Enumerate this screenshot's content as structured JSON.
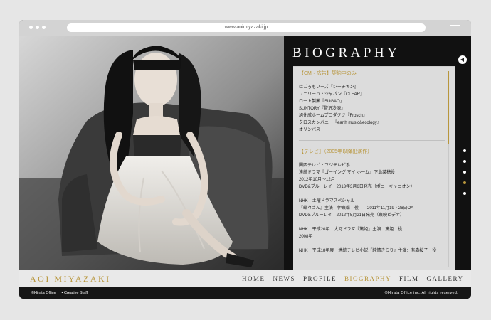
{
  "browser": {
    "url": "www.aoimiyazaki.jp"
  },
  "page": {
    "title": "BIOGRAPHY"
  },
  "biography": {
    "section_cm": {
      "heading": "【CM・広告】契約中のみ",
      "items": [
        "はごろもフーズ『シーチキン』",
        "ユニリーバ・ジャパン『CLEAR』",
        "ロート製薬『SUGAO』",
        "SUNTORY『贅沢冷凍』",
        "旭化成ホームプロダクツ『Frosch』",
        "クロスカンパニー『earth music&ecology』",
        "オリンパス"
      ]
    },
    "section_tv": {
      "heading": "【テレビ】（2005年以降出演作）",
      "entry1": [
        "関西テレビ・フジテレビ系",
        "連続ドラマ『ゴーイング マイ ホーム』下島菜穂役",
        "2012年10月〜12月",
        "DVD&ブルーレイ　2013年3月6日発売（ポニーキャニオン）"
      ],
      "entry2": [
        "NHK　土曜ドラマスペシャル",
        "『蝶々さん』主演：伊東蝶　役　　2011年11月19・26日OA",
        "DVD&ブルーレイ　2012年5月21日発売（東映ビデオ）"
      ],
      "entry3": [
        "NHK　平成20年　大河ドラマ『篤姫』主演：篤姫　役",
        "2008年"
      ],
      "entry4": [
        "NHK　平成18年度　連続テレビ小説『純情きらり』主演：有森桜子　役"
      ]
    }
  },
  "nav": {
    "logo": "AOI MIYAZAKI",
    "items": [
      "HOME",
      "NEWS",
      "PROFILE",
      "BIOGRAPHY",
      "FILM",
      "GALLERY"
    ],
    "active": "BIOGRAPHY"
  },
  "footer": {
    "left1": "©Hirata Office",
    "left2": "• Creative Staff",
    "right": "©Hirata Office inc. All rights reserved."
  },
  "colors": {
    "accent": "#b8963c",
    "background": "#e6e6e6",
    "dark": "#161616",
    "panel": "#dcdcdc"
  },
  "icons": {
    "sound": "play-sound-icon",
    "menu": "hamburger-menu-icon"
  },
  "side_nav": {
    "count": 5,
    "active_index": 3
  }
}
